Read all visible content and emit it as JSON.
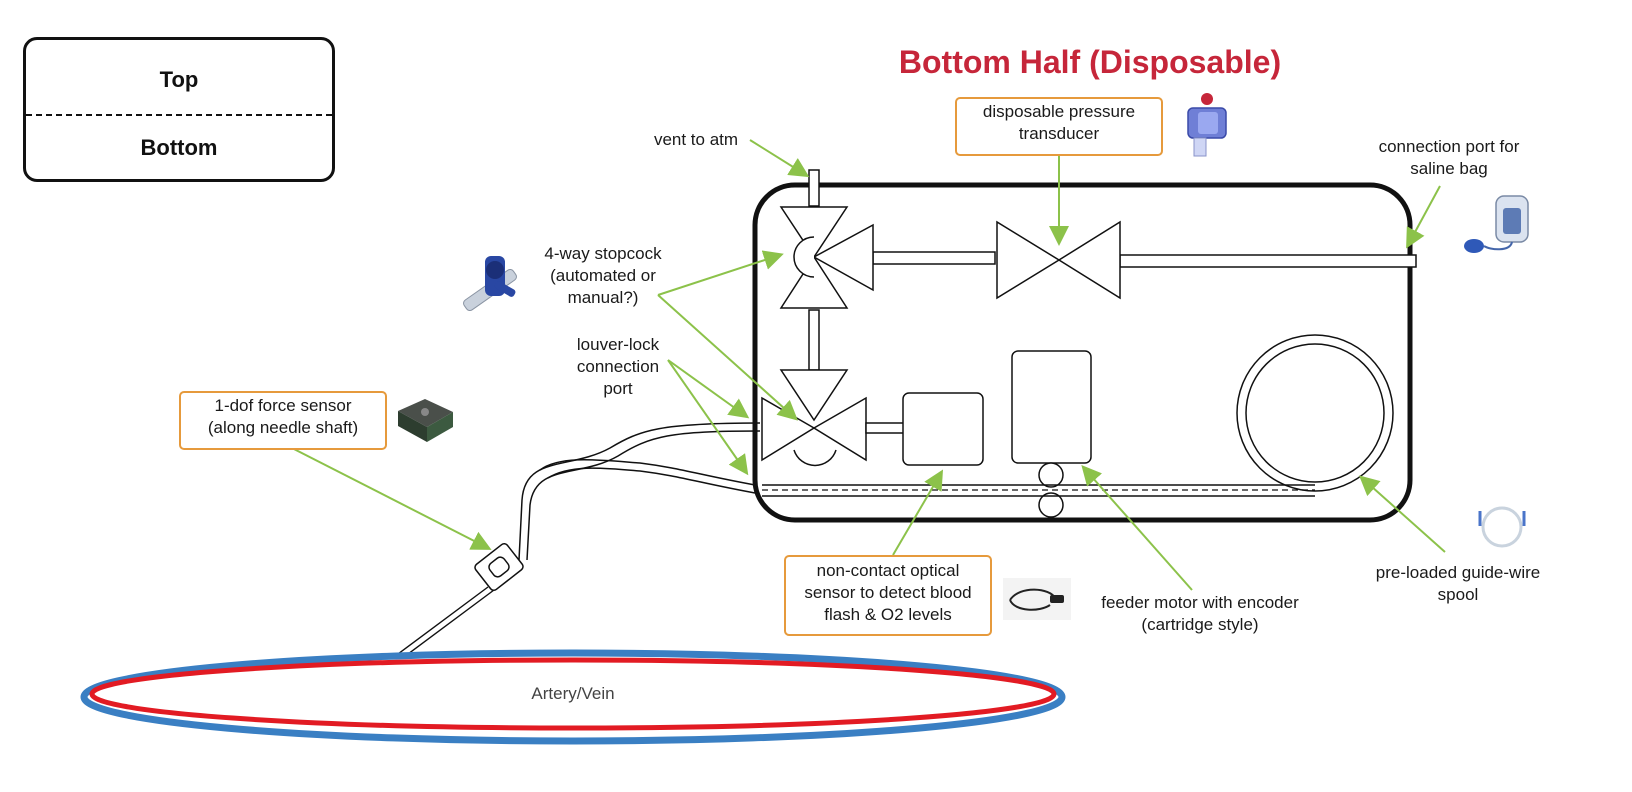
{
  "legend": {
    "top": "Top",
    "bottom": "Bottom"
  },
  "title": "Bottom Half (Disposable)",
  "labels": {
    "pressure_line1": "disposable pressure",
    "pressure_line2": "transducer",
    "vent": "vent to atm",
    "saline_line1": "connection port for",
    "saline_line2": "saline bag",
    "stopcock_line1": "4-way stopcock",
    "stopcock_line2": "(automated or",
    "stopcock_line3": "manual?)",
    "louver_line1": "louver-lock",
    "louver_line2": "connection",
    "louver_line3": "port",
    "force_line1": "1-dof force sensor",
    "force_line2": "(along needle shaft)",
    "optical_line1": "non-contact optical",
    "optical_line2": "sensor to detect blood",
    "optical_line3": "flash & O2 levels",
    "feeder_line1": "feeder motor with encoder",
    "feeder_line2": "(cartridge style)",
    "spool_line1": "pre-loaded guide-wire",
    "spool_line2": "spool",
    "vessel": "Artery/Vein"
  },
  "colors": {
    "title": "#c6263a",
    "arrow": "#8cc24a",
    "callout_border": "#e69a3c",
    "vessel_outer": "#3a7fc3",
    "vessel_inner": "#e21b23"
  }
}
